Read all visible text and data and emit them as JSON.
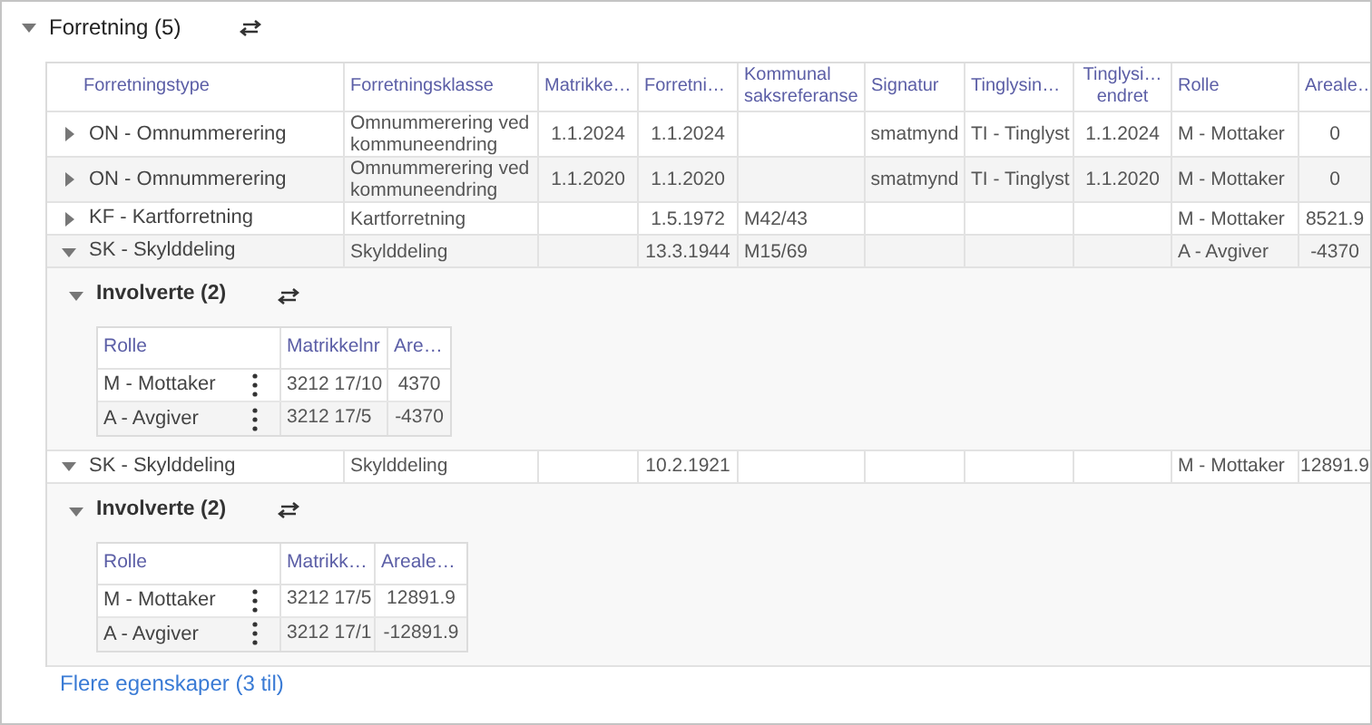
{
  "section": {
    "title": "Forretning (5)",
    "expanded": true
  },
  "table": {
    "columns": [
      "Forretningstype",
      "Forretningsklasse",
      "Matrikke…",
      "Forretni…",
      "Kommunal saksreferanse",
      "Signatur",
      "Tinglysin…",
      "Tinglysi… endret",
      "Rolle",
      "Areale…"
    ],
    "rows": [
      {
        "expanded": false,
        "cells": [
          "ON - Omnummerering",
          "Omnummerering ved kommuneendring",
          "1.1.2024",
          "1.1.2024",
          null,
          "smatmynd",
          "TI - Tinglyst",
          "1.1.2024",
          "M - Mottaker",
          "0"
        ]
      },
      {
        "expanded": false,
        "cells": [
          "ON - Omnummerering",
          "Omnummerering ved kommuneendring",
          "1.1.2020",
          "1.1.2020",
          null,
          "smatmynd",
          "TI - Tinglyst",
          "1.1.2020",
          "M - Mottaker",
          "0"
        ]
      },
      {
        "expanded": false,
        "cells": [
          "KF - Kartforretning",
          "Kartforretning",
          null,
          "1.5.1972",
          "M42/43",
          null,
          null,
          null,
          "M - Mottaker",
          "8521.9"
        ]
      },
      {
        "expanded": true,
        "cells": [
          "SK - Skylddeling",
          "Skylddeling",
          null,
          "13.3.1944",
          "M15/69",
          null,
          null,
          null,
          "A - Avgiver",
          "-4370"
        ],
        "involved": {
          "title": "Involverte (2)",
          "expanded": true,
          "columns": [
            "Rolle",
            "Matrikkelnr",
            "Are…"
          ],
          "rows": [
            [
              "M - Mottaker",
              "3212 17/10",
              "4370"
            ],
            [
              "A - Avgiver",
              "3212 17/5",
              "-4370"
            ]
          ]
        }
      },
      {
        "expanded": true,
        "cells": [
          "SK - Skylddeling",
          "Skylddeling",
          null,
          "10.2.1921",
          null,
          null,
          null,
          null,
          "M - Mottaker",
          "12891.9"
        ],
        "involved": {
          "title": "Involverte (2)",
          "expanded": true,
          "columns": [
            "Rolle",
            "Matrikk…",
            "Areale…"
          ],
          "rows": [
            [
              "M - Mottaker",
              "3212 17/5",
              "12891.9"
            ],
            [
              "A - Avgiver",
              "3212 17/1",
              "-12891.9"
            ]
          ]
        }
      }
    ]
  },
  "more_link": "Flere egenskaper (3 til)"
}
